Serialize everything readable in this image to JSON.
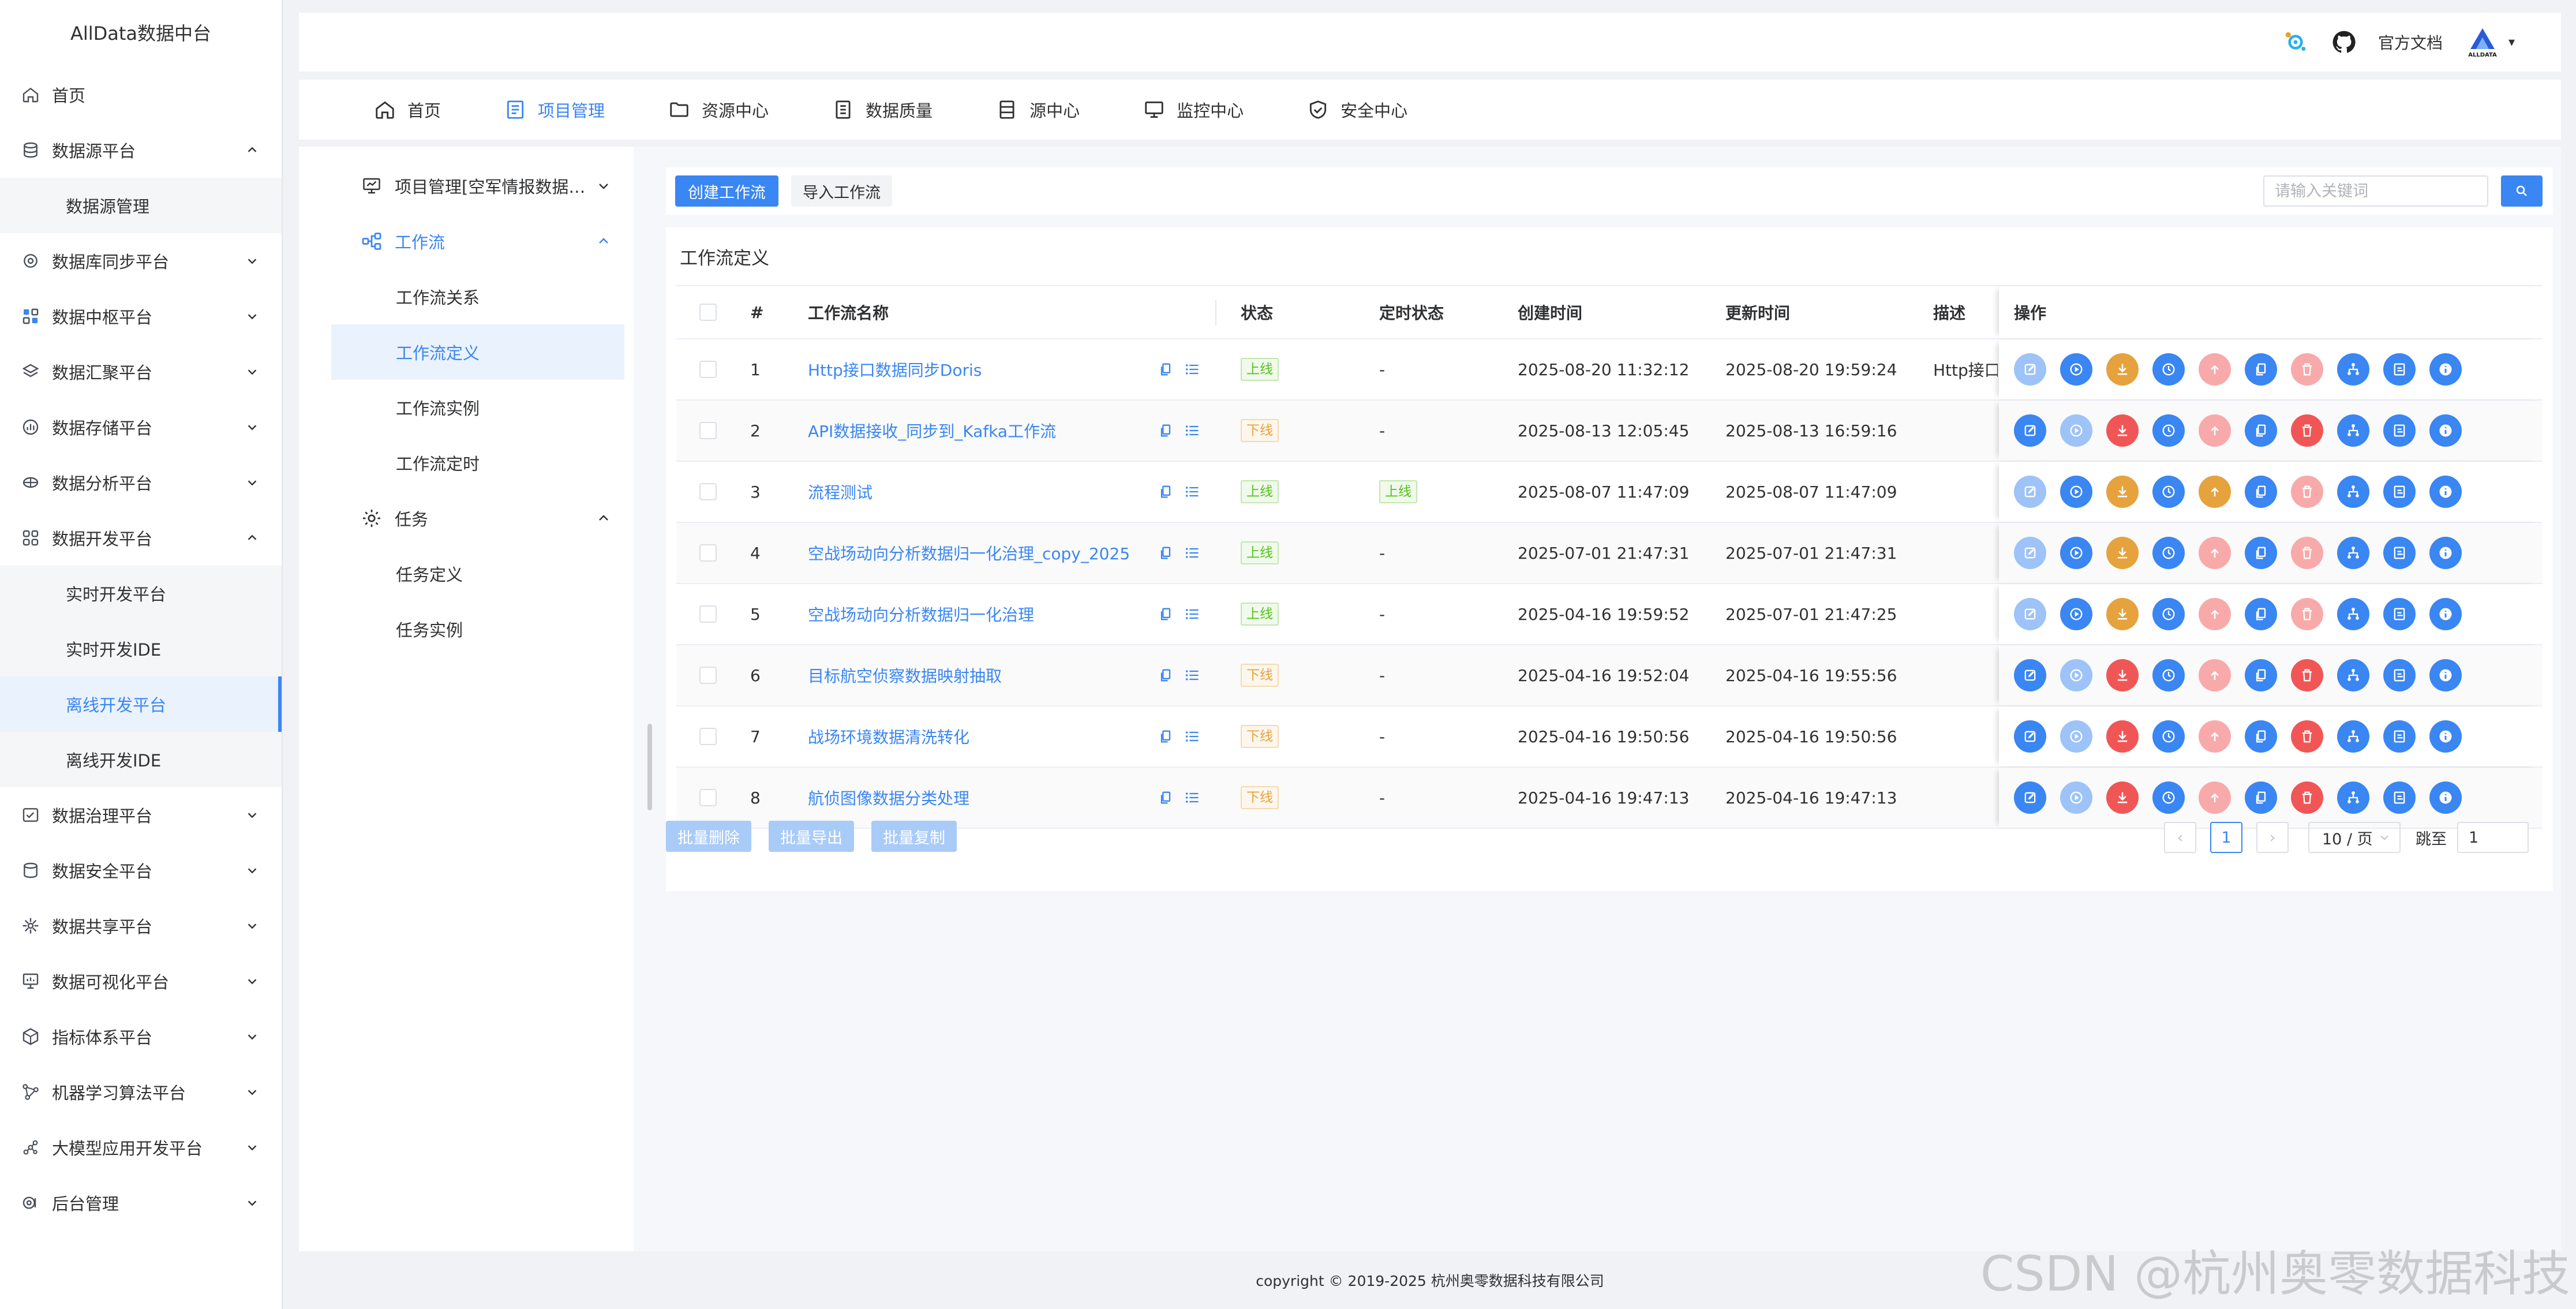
{
  "app_title": "AllData数据中台",
  "sidebar": {
    "items": [
      {
        "label": "首页",
        "icon": "home-icon",
        "expandable": false
      },
      {
        "label": "数据源平台",
        "icon": "database-icon",
        "expandable": true,
        "open": true
      },
      {
        "label": "数据源管理",
        "sub": true
      },
      {
        "label": "数据库同步平台",
        "icon": "sync-icon",
        "expandable": true
      },
      {
        "label": "数据中枢平台",
        "icon": "hub-icon",
        "expandable": true
      },
      {
        "label": "数据汇聚平台",
        "icon": "layers-icon",
        "expandable": true
      },
      {
        "label": "数据存储平台",
        "icon": "storage-icon",
        "expandable": true
      },
      {
        "label": "数据分析平台",
        "icon": "analysis-icon",
        "expandable": true
      },
      {
        "label": "数据开发平台",
        "icon": "develop-icon",
        "expandable": true,
        "open": true,
        "active": true
      },
      {
        "label": "实时开发平台",
        "sub": true
      },
      {
        "label": "实时开发IDE",
        "sub": true
      },
      {
        "label": "离线开发平台",
        "sub": true,
        "selected": true
      },
      {
        "label": "离线开发IDE",
        "sub": true
      },
      {
        "label": "数据治理平台",
        "icon": "governance-icon",
        "expandable": true
      },
      {
        "label": "数据安全平台",
        "icon": "security-icon",
        "expandable": true
      },
      {
        "label": "数据共享平台",
        "icon": "share-icon",
        "expandable": true
      },
      {
        "label": "数据可视化平台",
        "icon": "visual-icon",
        "expandable": true
      },
      {
        "label": "指标体系平台",
        "icon": "metrics-icon",
        "expandable": true
      },
      {
        "label": "机器学习算法平台",
        "icon": "ml-icon",
        "expandable": true
      },
      {
        "label": "大模型应用开发平台",
        "icon": "llm-icon",
        "expandable": true
      },
      {
        "label": "后台管理",
        "icon": "admin-icon",
        "expandable": true
      }
    ]
  },
  "header": {
    "docs_label": "官方文档",
    "avatar_text": "ALLDATA",
    "caret": "▾"
  },
  "topnav": [
    {
      "label": "首页",
      "icon": "home-icon"
    },
    {
      "label": "项目管理",
      "icon": "project-icon",
      "active": true
    },
    {
      "label": "资源中心",
      "icon": "folder-icon"
    },
    {
      "label": "数据质量",
      "icon": "quality-icon"
    },
    {
      "label": "源中心",
      "icon": "source-icon"
    },
    {
      "label": "监控中心",
      "icon": "monitor-icon"
    },
    {
      "label": "安全中心",
      "icon": "shield-icon"
    }
  ],
  "subnav": {
    "project": "项目管理[空军情报数据资源一体化]",
    "workflow_group": "工作流",
    "workflow_items": [
      "工作流关系",
      "工作流定义",
      "工作流实例",
      "工作流定时"
    ],
    "task_group": "任务",
    "task_items": [
      "任务定义",
      "任务实例"
    ]
  },
  "toolbar": {
    "create_label": "创建工作流",
    "import_label": "导入工作流",
    "search_placeholder": "请输入关键词"
  },
  "panel_title": "工作流定义",
  "table": {
    "columns": [
      "#",
      "工作流名称",
      "状态",
      "定时状态",
      "创建时间",
      "更新时间",
      "描述",
      "操作"
    ],
    "rows": [
      {
        "no": "1",
        "name": "Http接口数据同步Doris",
        "status": "上线",
        "status_kind": "on",
        "sched": "-",
        "sched_kind": "none",
        "created": "2025-08-20 11:32:12",
        "updated": "2025-08-20 19:59:24",
        "desc": "Http接口数据",
        "online": true
      },
      {
        "no": "2",
        "name": "API数据接收_同步到_Kafka工作流",
        "status": "下线",
        "status_kind": "off",
        "sched": "-",
        "sched_kind": "none",
        "created": "2025-08-13 12:05:45",
        "updated": "2025-08-13 16:59:16",
        "desc": "",
        "online": false
      },
      {
        "no": "3",
        "name": "流程测试",
        "status": "上线",
        "status_kind": "on",
        "sched": "上线",
        "sched_kind": "on",
        "created": "2025-08-07 11:47:09",
        "updated": "2025-08-07 11:47:09",
        "desc": "",
        "online": true
      },
      {
        "no": "4",
        "name": "空战场动向分析数据归一化治理_copy_2025",
        "status": "上线",
        "status_kind": "on",
        "sched": "-",
        "sched_kind": "none",
        "created": "2025-07-01 21:47:31",
        "updated": "2025-07-01 21:47:31",
        "desc": "",
        "online": true
      },
      {
        "no": "5",
        "name": "空战场动向分析数据归一化治理",
        "status": "上线",
        "status_kind": "on",
        "sched": "-",
        "sched_kind": "none",
        "created": "2025-04-16 19:59:52",
        "updated": "2025-07-01 21:47:25",
        "desc": "",
        "online": true
      },
      {
        "no": "6",
        "name": "目标航空侦察数据映射抽取",
        "status": "下线",
        "status_kind": "off",
        "sched": "-",
        "sched_kind": "none",
        "created": "2025-04-16 19:52:04",
        "updated": "2025-04-16 19:55:56",
        "desc": "",
        "online": false
      },
      {
        "no": "7",
        "name": "战场环境数据清洗转化",
        "status": "下线",
        "status_kind": "off",
        "sched": "-",
        "sched_kind": "none",
        "created": "2025-04-16 19:50:56",
        "updated": "2025-04-16 19:50:56",
        "desc": "",
        "online": false
      },
      {
        "no": "8",
        "name": "航侦图像数据分类处理",
        "status": "下线",
        "status_kind": "off",
        "sched": "-",
        "sched_kind": "none",
        "created": "2025-04-16 19:47:13",
        "updated": "2025-04-16 19:47:13",
        "desc": "",
        "online": false
      }
    ]
  },
  "batch": {
    "delete_label": "批量删除",
    "export_label": "批量导出",
    "copy_label": "批量复制"
  },
  "pagination": {
    "prev": "‹",
    "current": "1",
    "next": "›",
    "page_size": "10 / 页",
    "goto_label": "跳至",
    "goto_value": "1"
  },
  "footer": {
    "copyright": "copyright © 2019-2025 杭州奥零数据科技有限公司"
  },
  "watermark": "CSDN @杭州奥零数据科技",
  "colors": {
    "primary": "#3a86f2",
    "primary_light": "#9dc3f8",
    "warning": "#e6a23c",
    "danger": "#f15656",
    "danger_light": "#f8aaaa",
    "success": "#52c41a"
  }
}
